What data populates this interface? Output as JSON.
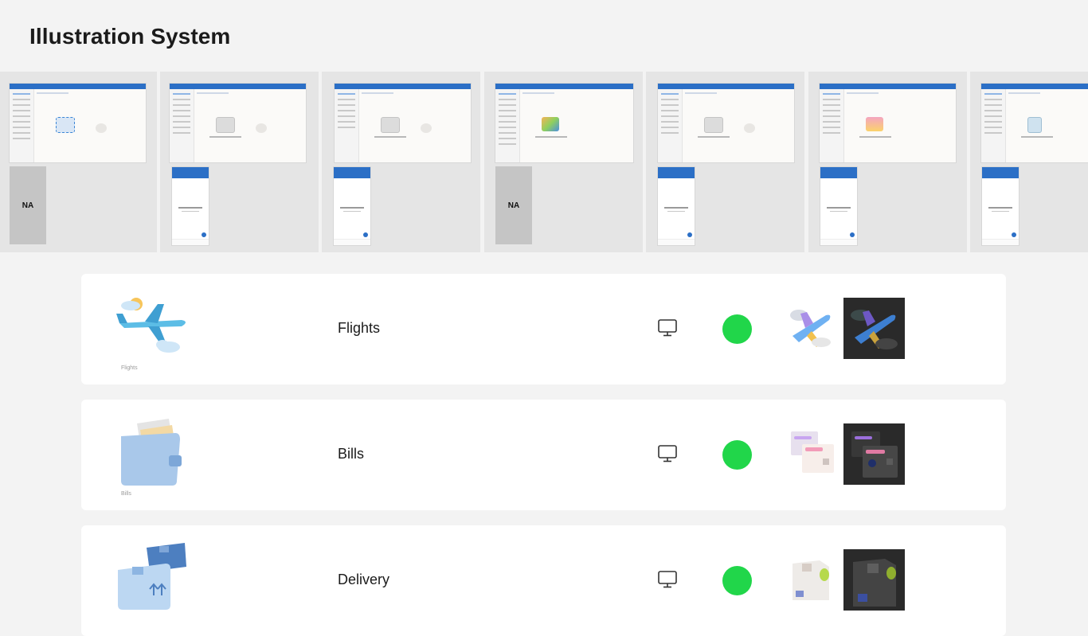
{
  "page": {
    "title": "Illustration System"
  },
  "preview_strip": {
    "columns": [
      {
        "desktop": "blue-envelope",
        "mobile": "NA"
      },
      {
        "desktop": "gray-envelope",
        "mobile": "screen"
      },
      {
        "desktop": "gray-envelope",
        "mobile": "screen"
      },
      {
        "desktop": "color-illustration",
        "mobile": "NA"
      },
      {
        "desktop": "gray-check",
        "mobile": "screen"
      },
      {
        "desktop": "folder",
        "mobile": "screen"
      },
      {
        "desktop": "trash",
        "mobile": "screen"
      }
    ],
    "na_label": "NA"
  },
  "rows": [
    {
      "name": "Flights",
      "caption": "Flights",
      "icon": "airplane-illustration",
      "platform": "desktop-icon",
      "status_color": "#21d64a"
    },
    {
      "name": "Bills",
      "caption": "Bills",
      "icon": "wallet-illustration",
      "platform": "desktop-icon",
      "status_color": "#21d64a"
    },
    {
      "name": "Delivery",
      "caption": "",
      "icon": "package-illustration",
      "platform": "desktop-icon",
      "status_color": "#21d64a"
    }
  ]
}
